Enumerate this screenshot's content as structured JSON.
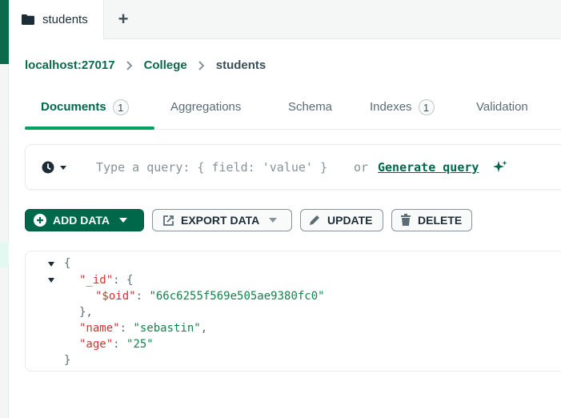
{
  "tab": {
    "title": "students",
    "add_symbol": "+"
  },
  "breadcrumb": {
    "host": "localhost:27017",
    "db": "College",
    "collection": "students"
  },
  "subtabs": [
    {
      "label": "Documents",
      "count": "1"
    },
    {
      "label": "Aggregations"
    },
    {
      "label": "Schema"
    },
    {
      "label": "Indexes",
      "count": "1"
    },
    {
      "label": "Validation"
    }
  ],
  "query": {
    "placeholder": "Type a query: { field: 'value' }",
    "or_text": "or",
    "generate_label": "Generate query"
  },
  "actions": {
    "add_data": "ADD DATA",
    "export_data": "EXPORT DATA",
    "update": "UPDATE",
    "delete": "DELETE"
  },
  "document": {
    "open_brace": "{",
    "close_brace": "}",
    "id_key": "\"_id\"",
    "id_open": "{",
    "oid_key": "\"$oid\"",
    "oid_value": "\"66c6255f569e505ae9380fc0\"",
    "id_close": "},",
    "name_key": "\"name\"",
    "name_value": "\"sebastin\"",
    "age_key": "\"age\"",
    "age_value": "\"25\""
  },
  "colors": {
    "accent": "#00684a",
    "active_underline": "#00a35c",
    "json_key": "#db3030",
    "json_string": "#12824d"
  }
}
